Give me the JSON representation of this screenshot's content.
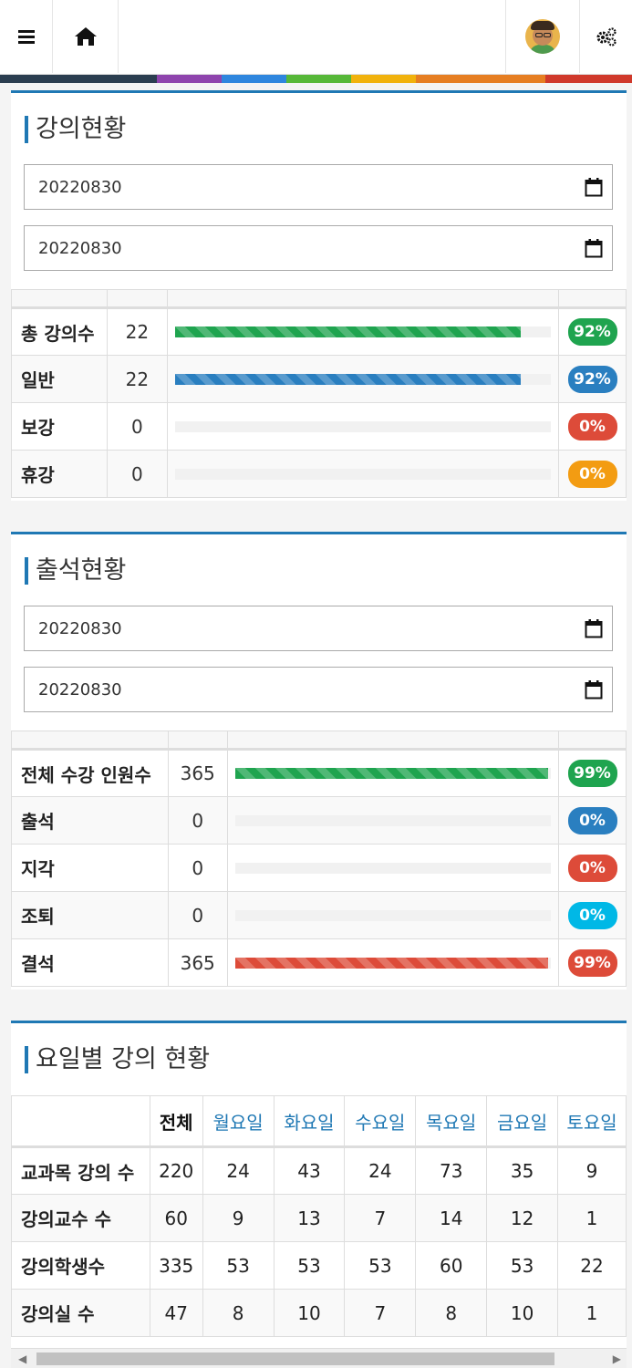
{
  "header": {
    "menu_icon": "hamburger-icon",
    "home_icon": "home-icon",
    "avatar_icon": "user-avatar",
    "settings_icon": "gears-icon",
    "strip_colors": [
      "#2b3e50",
      "#8e44ad",
      "#2e86de",
      "#56b838",
      "#f1b20c",
      "#e67e22",
      "#d0392b"
    ]
  },
  "lecture_status": {
    "title": "강의현황",
    "date_from": "20220830",
    "date_to": "20220830",
    "rows": [
      {
        "label": "총 강의수",
        "value": "22",
        "percent": 92,
        "badge": "92%",
        "color": "#1fa44f"
      },
      {
        "label": "일반",
        "value": "22",
        "percent": 92,
        "badge": "92%",
        "color": "#2a7fc0"
      },
      {
        "label": "보강",
        "value": "0",
        "percent": 0,
        "badge": "0%",
        "color": "#dd4b39"
      },
      {
        "label": "휴강",
        "value": "0",
        "percent": 0,
        "badge": "0%",
        "color": "#f39c12"
      }
    ]
  },
  "attendance_status": {
    "title": "출석현황",
    "date_from": "20220830",
    "date_to": "20220830",
    "rows": [
      {
        "label": "전체 수강 인원수",
        "value": "365",
        "percent": 99,
        "badge": "99%",
        "color": "#1fa44f"
      },
      {
        "label": "출석",
        "value": "0",
        "percent": 0,
        "badge": "0%",
        "color": "#2a7fc0"
      },
      {
        "label": "지각",
        "value": "0",
        "percent": 0,
        "badge": "0%",
        "color": "#dd4b39"
      },
      {
        "label": "조퇴",
        "value": "0",
        "percent": 0,
        "badge": "0%",
        "color": "#00b8e6"
      },
      {
        "label": "결석",
        "value": "365",
        "percent": 99,
        "badge": "99%",
        "color": "#dd4b39"
      }
    ]
  },
  "weekday_status": {
    "title": "요일별 강의 현황",
    "columns": [
      "전체",
      "월요일",
      "화요일",
      "수요일",
      "목요일",
      "금요일",
      "토요일"
    ],
    "rows": [
      {
        "label": "교과목 강의 수",
        "cells": [
          "220",
          "24",
          "43",
          "24",
          "73",
          "35",
          "9"
        ]
      },
      {
        "label": "강의교수 수",
        "cells": [
          "60",
          "9",
          "13",
          "7",
          "14",
          "12",
          "1"
        ]
      },
      {
        "label": "강의학생수",
        "cells": [
          "335",
          "53",
          "53",
          "53",
          "60",
          "53",
          "22"
        ]
      },
      {
        "label": "강의실 수",
        "cells": [
          "47",
          "8",
          "10",
          "7",
          "8",
          "10",
          "1"
        ]
      }
    ]
  }
}
